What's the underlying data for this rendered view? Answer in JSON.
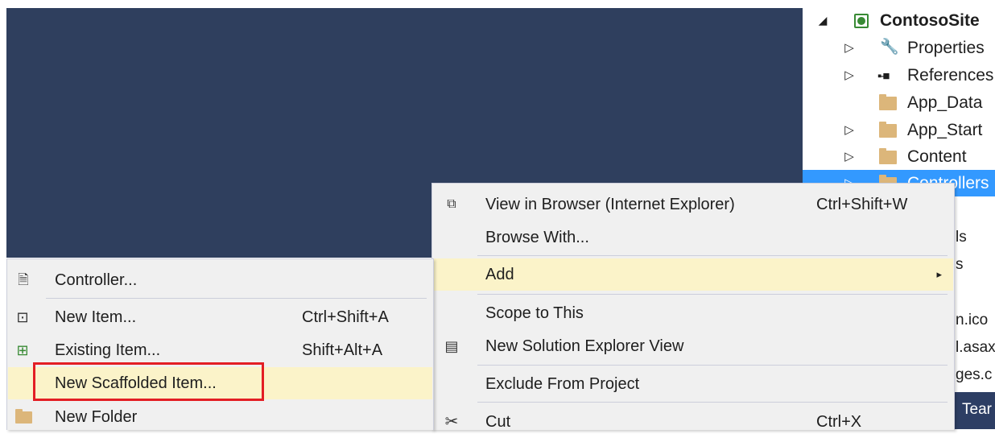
{
  "solution_explorer": {
    "items": [
      {
        "label": "ContosoSite",
        "expander": "open",
        "icon": "web-project-icon"
      },
      {
        "label": "Properties",
        "expander": "closed",
        "icon": "wrench-icon"
      },
      {
        "label": "References",
        "expander": "closed",
        "icon": "references-icon"
      },
      {
        "label": "App_Data",
        "expander": "none",
        "icon": "folder-icon"
      },
      {
        "label": "App_Start",
        "expander": "closed",
        "icon": "folder-icon"
      },
      {
        "label": "Content",
        "expander": "closed",
        "icon": "folder-icon"
      },
      {
        "label": "Controllers",
        "expander": "closed",
        "icon": "folder-icon",
        "selected": true
      }
    ],
    "partial_labels": [
      "ls",
      "s",
      "n.ico",
      "l.asax",
      "ges.c"
    ],
    "team_tab": "Tear"
  },
  "main_menu": {
    "items": [
      {
        "label": "View in Browser (Internet Explorer)",
        "shortcut": "Ctrl+Shift+W",
        "icon": "view-in-browser-icon"
      },
      {
        "label": "Browse With...",
        "shortcut": ""
      },
      {
        "label": "Add",
        "shortcut": "",
        "submenu": true,
        "highlighted": true
      },
      {
        "label": "Scope to This",
        "shortcut": ""
      },
      {
        "label": "New Solution Explorer View",
        "shortcut": "",
        "icon": "new-view-icon"
      },
      {
        "label": "Exclude From Project",
        "shortcut": ""
      },
      {
        "label": "Cut",
        "shortcut": "Ctrl+X",
        "icon": "scissors-icon"
      }
    ],
    "submenu_arrow": "▸"
  },
  "add_submenu": {
    "items": [
      {
        "label": "Controller...",
        "shortcut": "",
        "icon": "controller-icon"
      },
      {
        "label": "New Item...",
        "shortcut": "Ctrl+Shift+A",
        "icon": "new-item-icon"
      },
      {
        "label": "Existing Item...",
        "shortcut": "Shift+Alt+A",
        "icon": "existing-item-icon"
      },
      {
        "label": "New Scaffolded Item...",
        "shortcut": "",
        "highlighted": true,
        "annotated": true
      },
      {
        "label": "New Folder",
        "shortcut": "",
        "icon": "new-folder-icon"
      }
    ]
  },
  "colors": {
    "editor_background": "#2f3f5e",
    "menu_background": "#f0f0f0",
    "menu_highlight": "#fbf3c9",
    "tree_selection": "#3399ff",
    "annotation_box": "#e31e24"
  }
}
